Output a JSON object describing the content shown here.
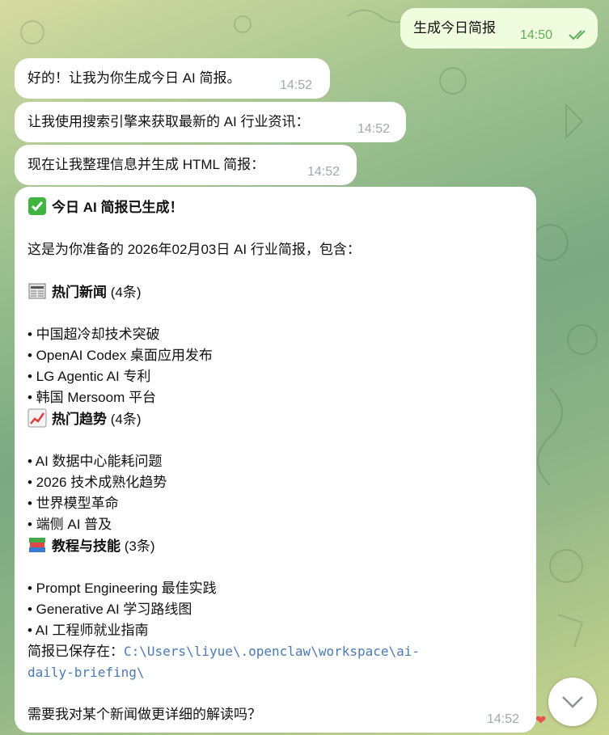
{
  "messages": {
    "outgoing": {
      "text": "生成今日简报",
      "time": "14:50"
    },
    "reply1": {
      "text": "好的！让我为你生成今日 AI 简报。",
      "time": "14:52"
    },
    "reply2": {
      "text": "让我使用搜索引擎来获取最新的 AI 行业资讯：",
      "time": "14:52"
    },
    "reply3": {
      "text": "现在让我整理信息并生成 HTML 简报：",
      "time": "14:52"
    }
  },
  "briefing": {
    "title": "今日 AI 简报已生成！",
    "intro": "这是为你准备的 2026年02月03日 AI 行业简报，包含：",
    "sections": [
      {
        "icon": "newspaper-icon",
        "heading": "热门新闻",
        "count": "(4条)",
        "items": [
          "• 中国超冷却技术突破",
          "• OpenAI Codex 桌面应用发布",
          "• LG Agentic AI 专利",
          "• 韩国 Mersoom 平台"
        ]
      },
      {
        "icon": "chart-up-icon",
        "heading": "热门趋势",
        "count": "(4条)",
        "items": [
          "• AI 数据中心能耗问题",
          "• 2026 技术成熟化趋势",
          "• 世界模型革命",
          "• 端侧 AI 普及"
        ]
      },
      {
        "icon": "books-icon",
        "heading": "教程与技能",
        "count": "(3条)",
        "items": [
          "• Prompt Engineering 最佳实践",
          "• Generative AI 学习路线图",
          "• AI 工程师就业指南"
        ]
      }
    ],
    "saved_label": "简报已保存在：",
    "path_line1": "C:\\Users\\liyue\\.openclaw\\workspace\\ai-",
    "path_line2": "daily-briefing\\",
    "question": "需要我对某个新闻做更详细的解读吗？",
    "time": "14:52"
  },
  "colors": {
    "outgoing_bubble": "#effdde",
    "incoming_bubble": "#ffffff",
    "check_green": "#5fae5b",
    "heart": "#e8524a"
  }
}
